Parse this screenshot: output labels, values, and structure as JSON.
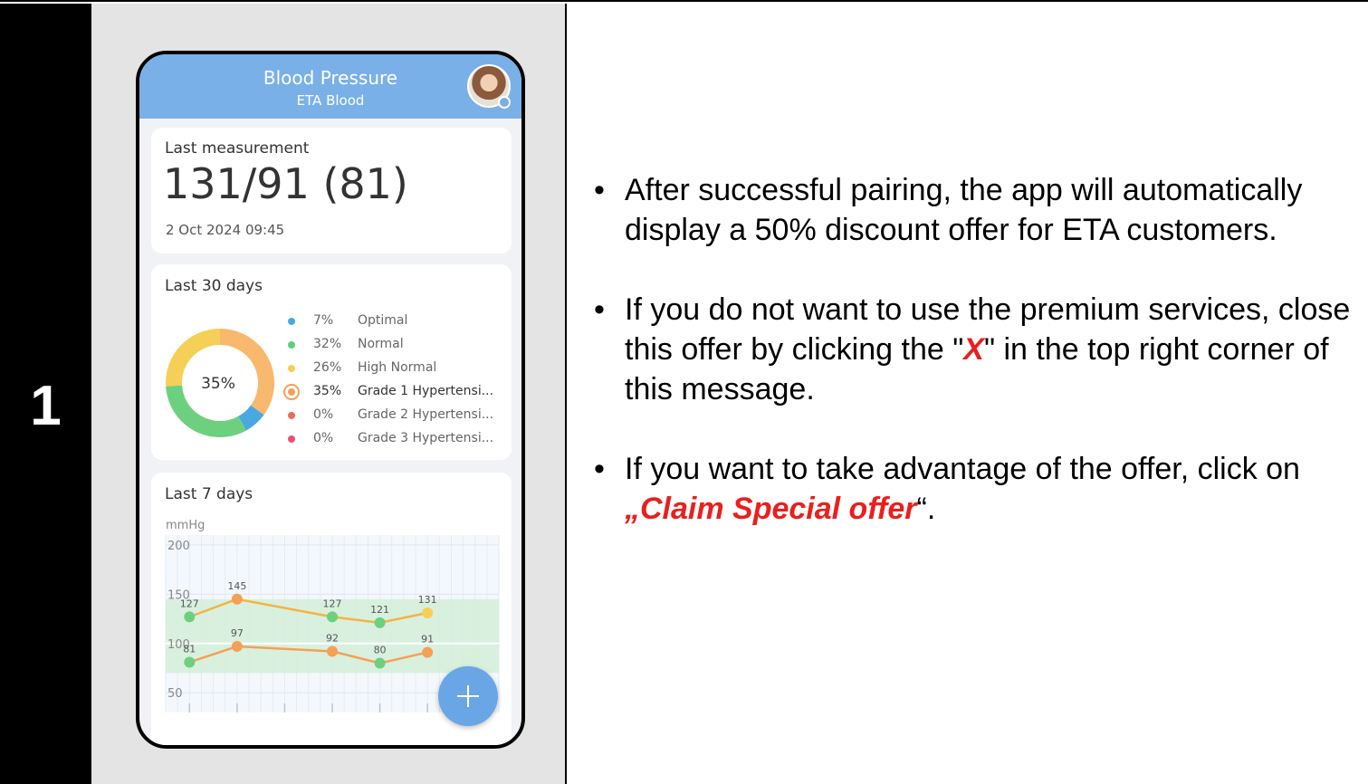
{
  "step_number": "1",
  "app": {
    "title": "Blood Pressure",
    "subtitle": "ETA Blood",
    "avatar_icon": "user-avatar-photo",
    "last_measurement": {
      "label": "Last measurement",
      "reading": "131/91 (81)",
      "date": "2 Oct 2024 09:45"
    },
    "last_30_days": {
      "label": "Last 30 days",
      "center_label": "35%",
      "legend": [
        {
          "pct": "7%",
          "name": "Optimal",
          "color": "#4aa8e0"
        },
        {
          "pct": "32%",
          "name": "Normal",
          "color": "#5fcf7a"
        },
        {
          "pct": "26%",
          "name": "High Normal",
          "color": "#f6cf56"
        },
        {
          "pct": "35%",
          "name": "Grade 1 Hypertensi...",
          "color": "#f5a055",
          "selected": true
        },
        {
          "pct": "0%",
          "name": "Grade 2 Hypertensi...",
          "color": "#f06a5a"
        },
        {
          "pct": "0%",
          "name": "Grade 3 Hypertensi...",
          "color": "#ec4f7a"
        }
      ]
    },
    "last_7_days": {
      "label": "Last 7 days",
      "unit": "mmHg",
      "y_ticks": [
        "200",
        "150",
        "100",
        "50"
      ]
    },
    "fab_icon": "plus-icon"
  },
  "chart_data": {
    "type": "line",
    "ylabel": "mmHg",
    "ylim": [
      30,
      210
    ],
    "yticks": [
      200,
      150,
      100,
      50
    ],
    "normal_band": [
      70,
      145
    ],
    "x_slots": 7,
    "series": [
      {
        "color": "#f5b340",
        "marker": [
          "#6dd07e",
          "#f5a055",
          "#6dd07e",
          "#6dd07e",
          "#f6cf56"
        ],
        "x": [
          0.5,
          1.5,
          3.5,
          4.5,
          5.5
        ],
        "values": [
          127,
          145,
          127,
          121,
          131
        ],
        "labels": [
          "127",
          "145",
          "127",
          "121",
          "131"
        ]
      },
      {
        "color": "#f5a055",
        "marker": [
          "#6dd07e",
          "#f5a055",
          "#f5a055",
          "#6dd07e",
          "#f5a055"
        ],
        "x": [
          0.5,
          1.5,
          3.5,
          4.5,
          5.5
        ],
        "values": [
          81,
          97,
          92,
          80,
          91
        ],
        "labels": [
          "81",
          "97",
          "92",
          "80",
          "91"
        ]
      }
    ]
  },
  "donut": {
    "segments": [
      {
        "value": 35,
        "color": "#f8b86e"
      },
      {
        "value": 7,
        "color": "#4aa8e0"
      },
      {
        "value": 32,
        "color": "#6dd07e"
      },
      {
        "value": 26,
        "color": "#f6cf56"
      }
    ]
  },
  "instructions": {
    "b1": "After successful pairing, the app will automatically display a 50% discount offer for ETA customers.",
    "b2_pre": "If you do not want to use the premium services, close this offer by clicking the \"",
    "b2_x": "X",
    "b2_post": "\" in the top right corner of this message.",
    "b3_pre": "If you want to take advantage of the offer, click on ",
    "b3_claim": "„Claim Special offer",
    "b3_post": "“.",
    "bullet": "•"
  }
}
